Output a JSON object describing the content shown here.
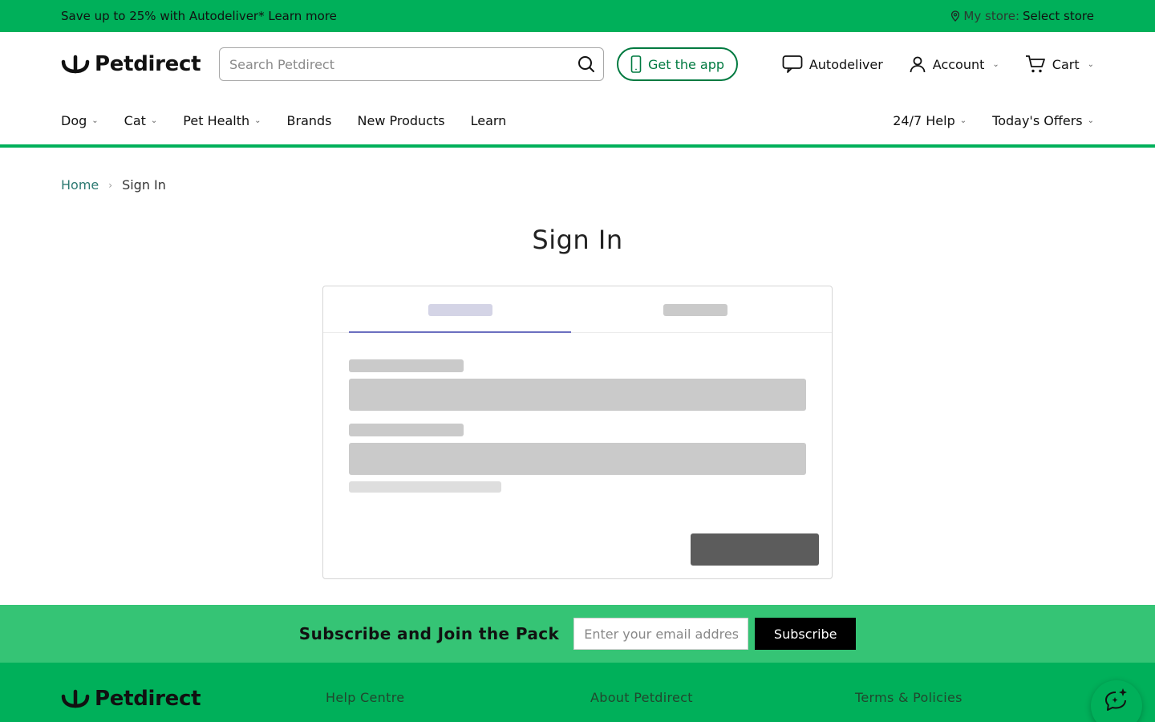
{
  "promo": {
    "text": "Save up to 25% with Autodeliver* Learn more",
    "store_label": "My store:",
    "store_value": "Select store"
  },
  "header": {
    "logo_text": "Petdirect",
    "search_placeholder": "Search Petdirect",
    "app_button": "Get the app",
    "autodeliver": "Autodeliver",
    "account": "Account",
    "cart": "Cart"
  },
  "nav": {
    "left": [
      "Dog",
      "Cat",
      "Pet Health",
      "Brands",
      "New Products",
      "Learn"
    ],
    "right": [
      "24/7 Help",
      "Today's Offers"
    ]
  },
  "breadcrumb": {
    "home": "Home",
    "current": "Sign In"
  },
  "page_title": "Sign In",
  "subscribe": {
    "title": "Subscribe and Join the Pack",
    "placeholder": "Enter your email address",
    "button": "Subscribe"
  },
  "footer": {
    "logo_text": "Petdirect",
    "columns": [
      "Help Centre",
      "About Petdirect",
      "Terms & Policies"
    ]
  },
  "colors": {
    "brand_green": "#00b05a",
    "subscribe_green": "#35c475",
    "app_green": "#007a40",
    "tab_accent": "#6c6fc0"
  }
}
